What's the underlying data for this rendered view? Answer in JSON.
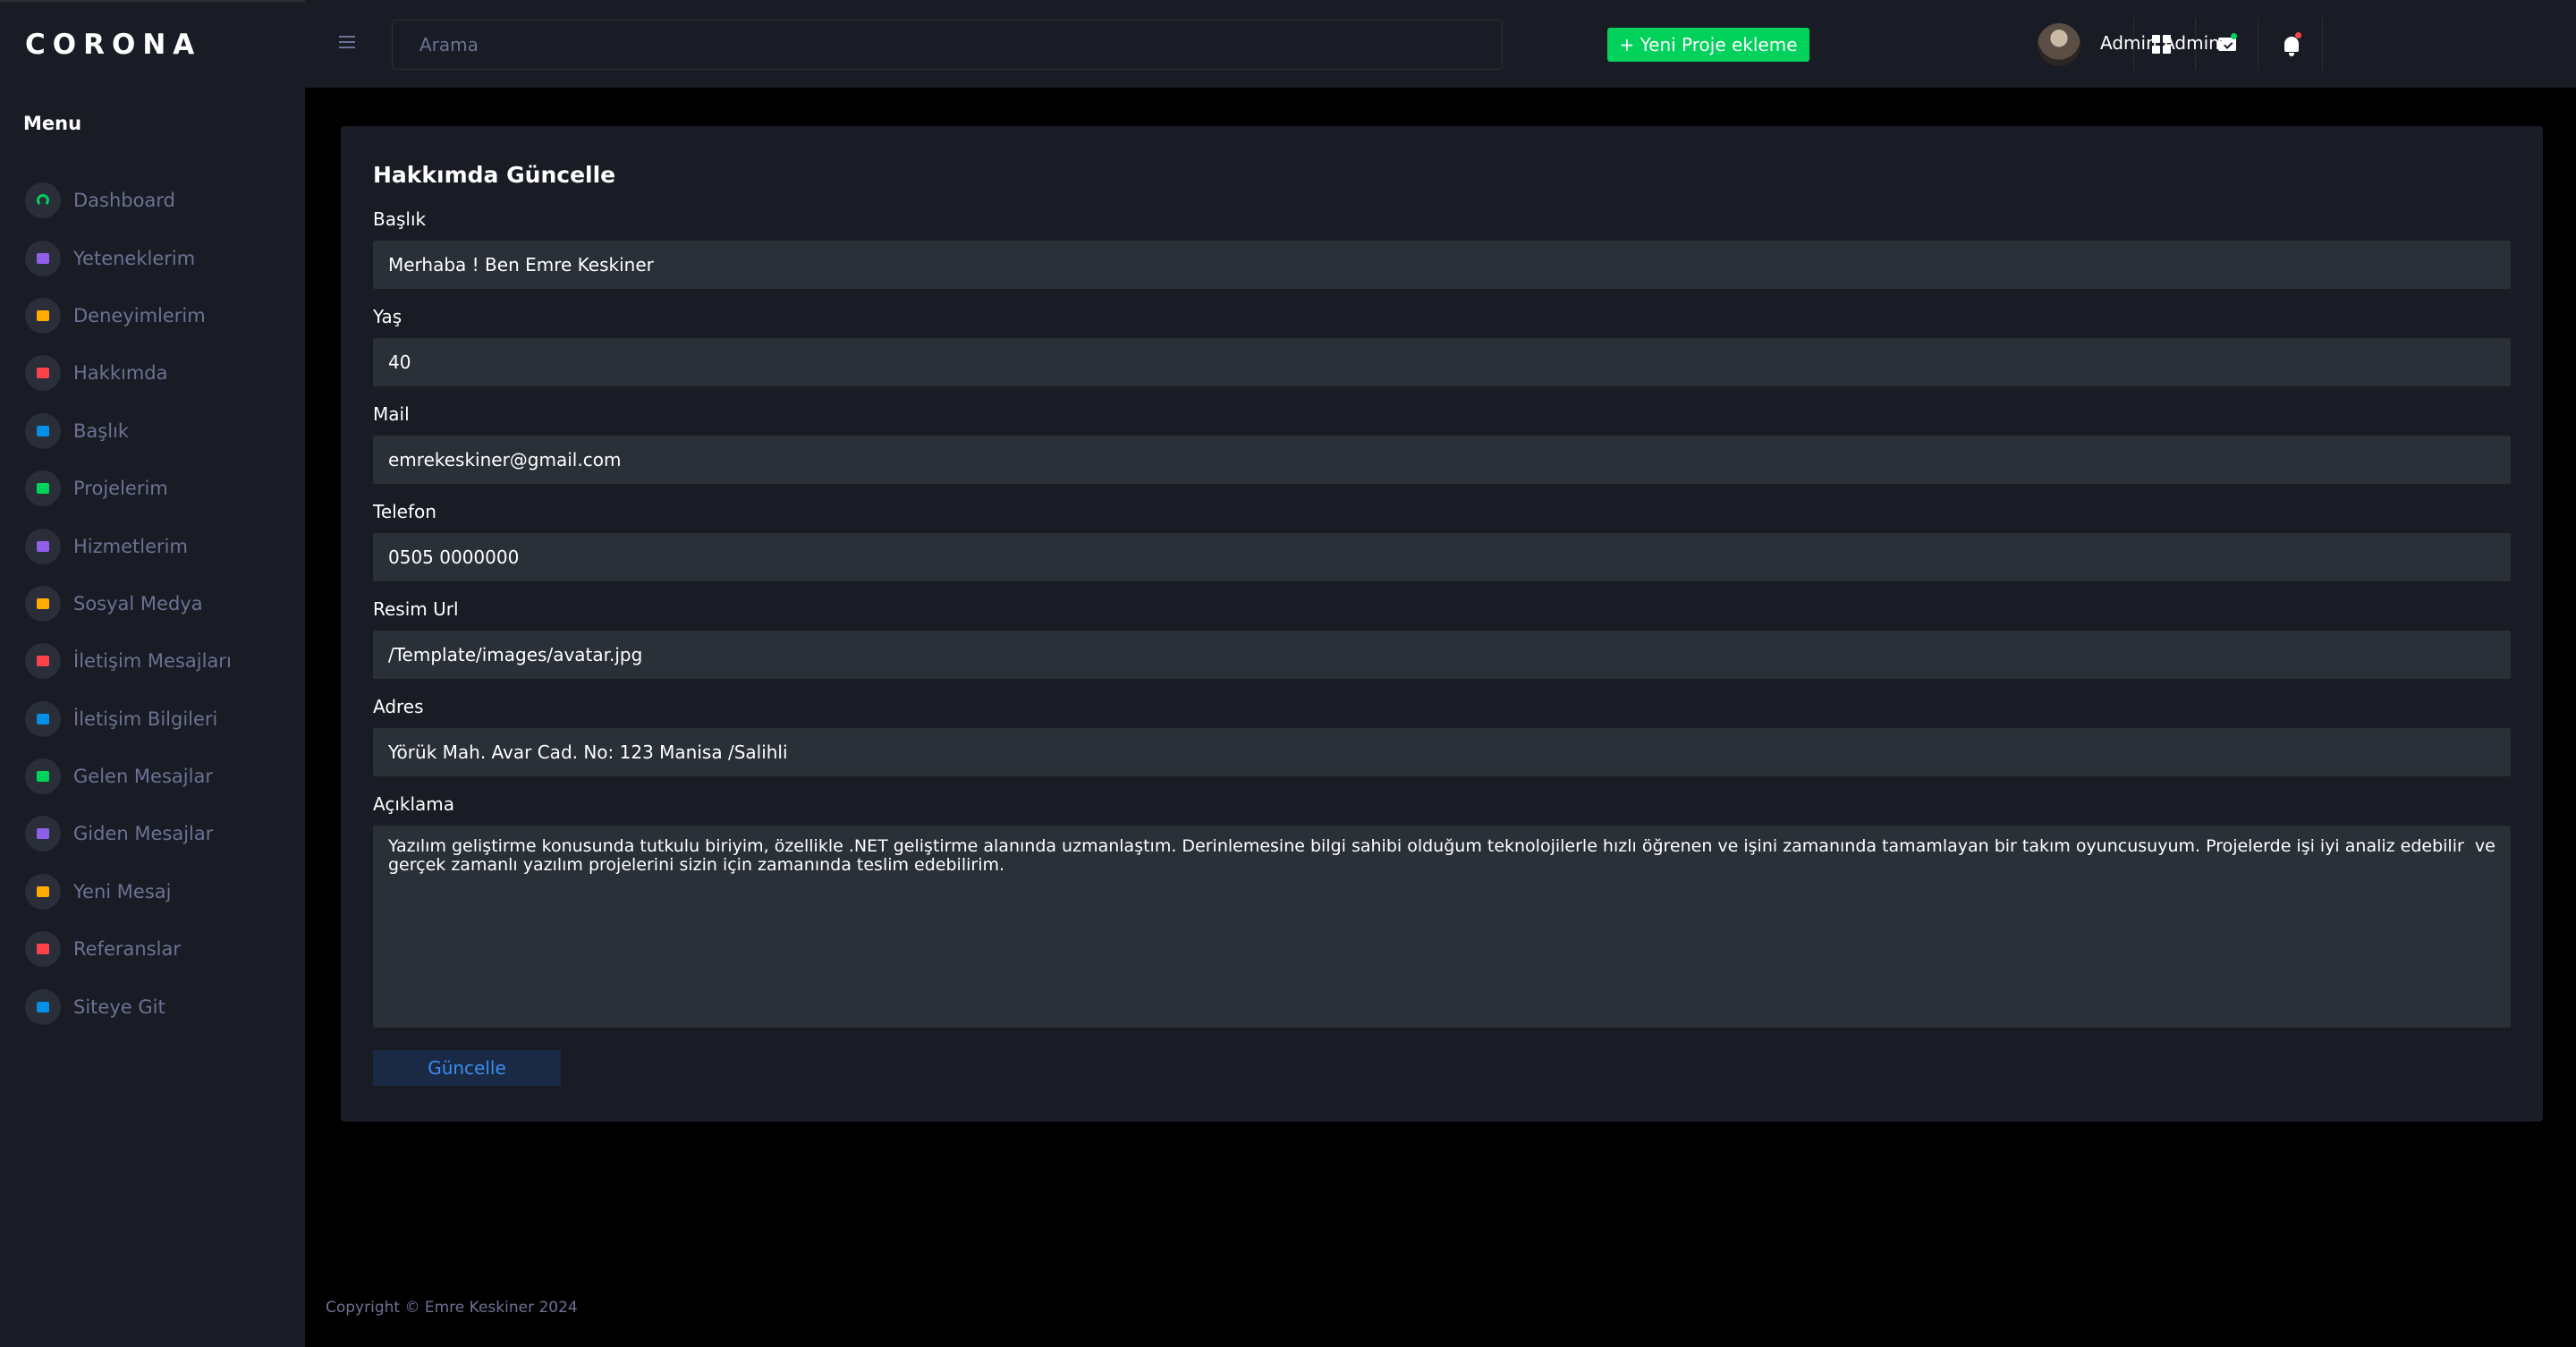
{
  "brand": "CORONA",
  "sidebar": {
    "menu_title": "Menu",
    "items": [
      {
        "label": "Dashboard",
        "icon": "speedometer-icon",
        "color": "#00d25b"
      },
      {
        "label": "Yeteneklerim",
        "icon": "laptop-icon",
        "color": "#8f5fe8"
      },
      {
        "label": "Deneyimlerim",
        "icon": "playlist-icon",
        "color": "#ffab00"
      },
      {
        "label": "Hakkımda",
        "icon": "table-icon",
        "color": "#fc424a"
      },
      {
        "label": "Başlık",
        "icon": "chart-bar-icon",
        "color": "#0090e7"
      },
      {
        "label": "Projelerim",
        "icon": "contacts-icon",
        "color": "#00d25b"
      },
      {
        "label": "Hizmetlerim",
        "icon": "contacts-icon",
        "color": "#8f5fe8"
      },
      {
        "label": "Sosyal Medya",
        "icon": "contacts-icon",
        "color": "#ffab00"
      },
      {
        "label": "İletişim Mesajları",
        "icon": "contacts-icon",
        "color": "#fc424a"
      },
      {
        "label": "İletişim Bilgileri",
        "icon": "contacts-icon",
        "color": "#0090e7"
      },
      {
        "label": "Gelen Mesajlar",
        "icon": "contacts-icon",
        "color": "#00d25b"
      },
      {
        "label": "Giden Mesajlar",
        "icon": "contacts-icon",
        "color": "#8f5fe8"
      },
      {
        "label": "Yeni Mesaj",
        "icon": "contacts-icon",
        "color": "#ffab00"
      },
      {
        "label": "Referanslar",
        "icon": "contacts-icon",
        "color": "#fc424a"
      },
      {
        "label": "Siteye Git",
        "icon": "contacts-icon",
        "color": "#0090e7"
      }
    ]
  },
  "topbar": {
    "search_placeholder": "Arama",
    "new_project_label": "+ Yeni Proje ekleme",
    "user_name": "Admin Admin",
    "mail_dot_color": "#00d25b",
    "bell_dot_color": "#fc424a"
  },
  "form": {
    "title": "Hakkımda Güncelle",
    "fields": [
      {
        "label": "Başlık",
        "value": "Merhaba ! Ben Emre Keskiner"
      },
      {
        "label": "Yaş",
        "value": "40"
      },
      {
        "label": "Mail",
        "value": "emrekeskiner@gmail.com"
      },
      {
        "label": "Telefon",
        "value": "0505 0000000"
      },
      {
        "label": "Resim Url",
        "value": "/Template/images/avatar.jpg"
      },
      {
        "label": "Adres",
        "value": "Yörük Mah. Avar Cad. No: 123 Manisa /Salihli"
      }
    ],
    "description_label": "Açıklama",
    "description_value": "Yazılım geliştirme konusunda tutkulu biriyim, özellikle .NET geliştirme alanında uzmanlaştım. Derinlemesine bilgi sahibi olduğum teknolojilerle hızlı öğrenen ve işini zamanında tamamlayan bir takım oyuncusuyum. Projelerde işi iyi analiz edebilir  ve gerçek zamanlı yazılım projelerini sizin için zamanında teslim edebilirim.",
    "submit_label": "Güncelle"
  },
  "footer": "Copyright © Emre Keskiner 2024"
}
